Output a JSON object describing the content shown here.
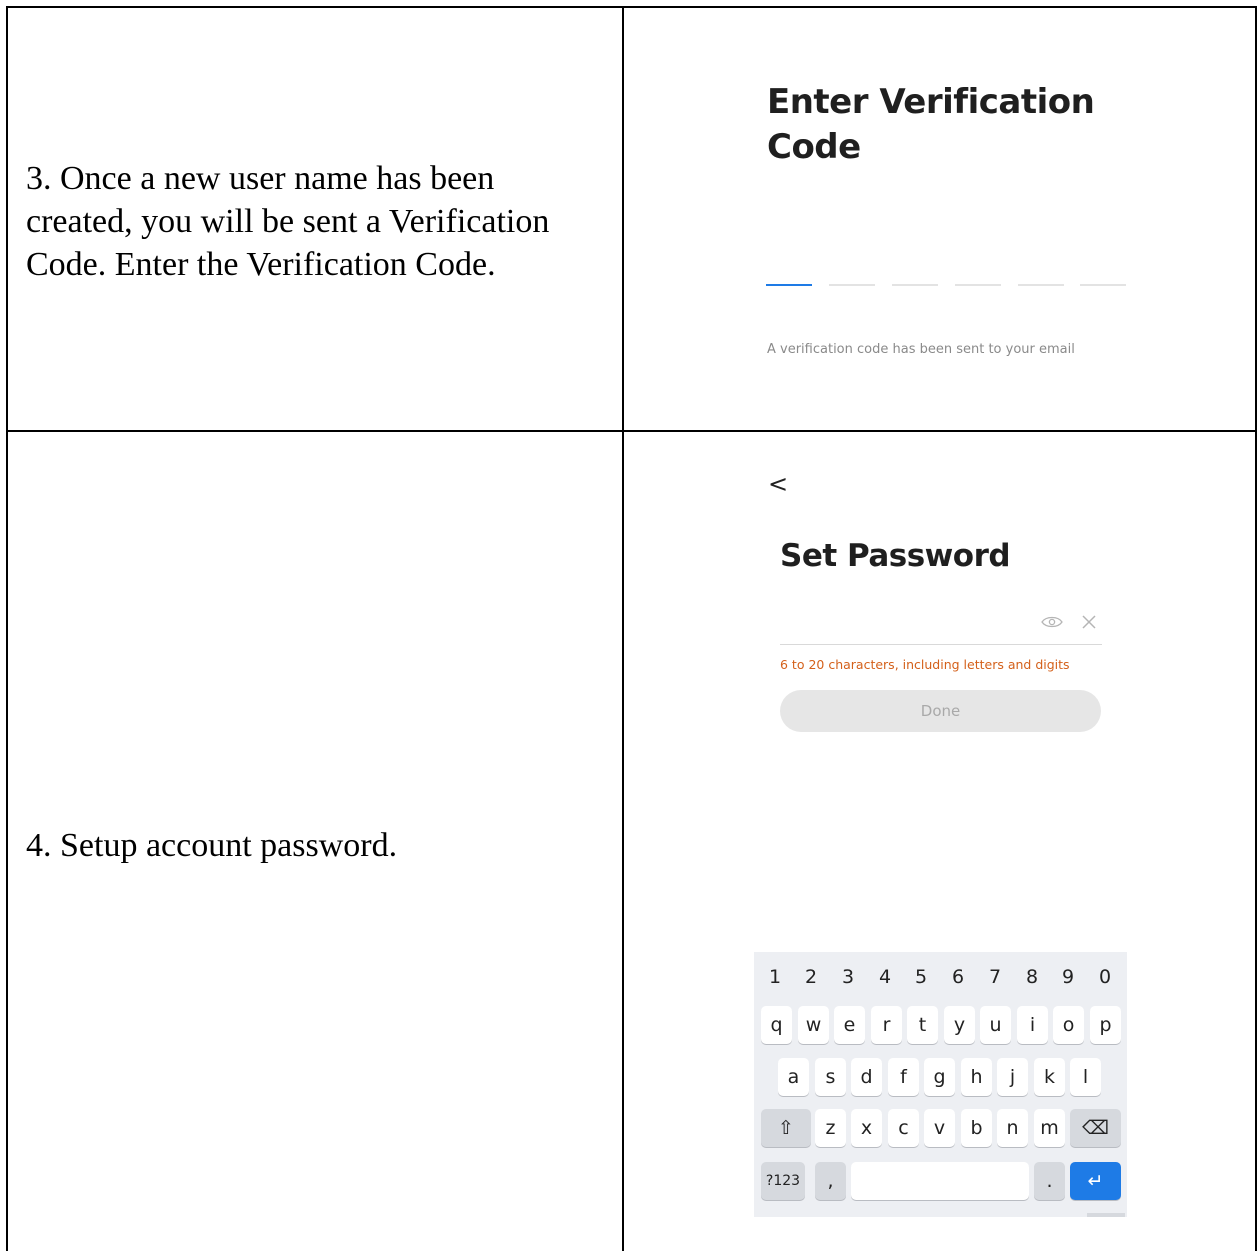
{
  "steps": [
    {
      "text_lines": [
        "3. Once a new user name has been",
        "created, you will be sent a Verification",
        "Code.  Enter the Verification Code."
      ]
    },
    {
      "text_lines": [
        "4. Setup account password."
      ]
    }
  ],
  "verification_screen": {
    "title_line1": "Enter Verification",
    "title_line2": "Code",
    "code_slots": 6,
    "note": "A verification code has been sent to your email",
    "accent_color": "#1e7be6"
  },
  "password_screen": {
    "back_icon": "chevron-left-icon",
    "back_glyph": "<",
    "title": "Set Password",
    "field_placeholder": "",
    "eye_icon": "eye-icon",
    "clear_icon": "close-icon",
    "hint": "6 to 20 characters, including letters and digits",
    "hint_color": "#d4601a",
    "done_label": "Done"
  },
  "keyboard": {
    "numbers": [
      "1",
      "2",
      "3",
      "4",
      "5",
      "6",
      "7",
      "8",
      "9",
      "0"
    ],
    "row1": [
      "q",
      "w",
      "e",
      "r",
      "t",
      "y",
      "u",
      "i",
      "o",
      "p"
    ],
    "row2": [
      "a",
      "s",
      "d",
      "f",
      "g",
      "h",
      "j",
      "k",
      "l"
    ],
    "row3": [
      "z",
      "x",
      "c",
      "v",
      "b",
      "n",
      "m"
    ],
    "shift_glyph": "⇧",
    "backspace_glyph": "⌫",
    "symbols_label": "?123",
    "comma_label": ",",
    "period_label": ".",
    "enter_glyph": "↵"
  }
}
